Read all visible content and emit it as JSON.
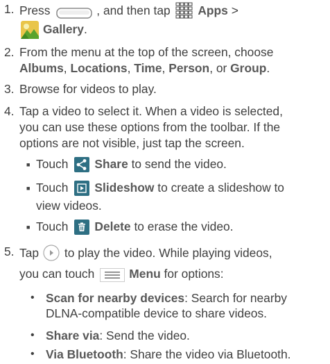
{
  "s1": {
    "num": "1.",
    "press": "Press",
    "mid": ", and then tap",
    "apps": "Apps",
    "gt": ">",
    "gallery": "Gallery",
    "end": "."
  },
  "s2": {
    "num": "2.",
    "l1": "From the menu at the top of the screen, choose",
    "albums": "Albums",
    "c1": ", ",
    "locations": "Locations",
    "c2": ", ",
    "time": "Time",
    "c3": ", ",
    "person": "Person",
    "c4": ", or ",
    "group": "Group",
    "end": "."
  },
  "s3": {
    "num": "3.",
    "text": "Browse for videos to play."
  },
  "s4": {
    "num": "4.",
    "l1": "Tap a video to select it. When a video is selected,",
    "l2": "you can use these options from the toolbar. If the",
    "l3": "options are not visible, just tap the screen."
  },
  "b1": {
    "touch": "Touch",
    "label": "Share",
    "rest": " to send the video."
  },
  "b2": {
    "touch": "Touch",
    "label": "Slideshow",
    "rest": " to create a slideshow to",
    "l2": "view videos."
  },
  "b3": {
    "touch": "Touch",
    "label": "Delete",
    "rest": " to erase the video."
  },
  "s5": {
    "num": "5.",
    "tap": "Tap",
    "rest": " to play the video. While playing videos,",
    "l2a": "you can touch",
    "menu": "Menu",
    "l2b": " for options:"
  },
  "opts": [
    {
      "label": "Scan for nearby devices",
      "desc": ": Search for nearby",
      "l2": "DLNA-compatible device to share videos."
    },
    {
      "label": "Share via",
      "desc": ": Send the video."
    },
    {
      "label": "Via Bluetooth",
      "desc": ": Share the video via Bluetooth."
    }
  ],
  "colors": {
    "text": "#3f3f3f",
    "bold": "#585858",
    "icon": "#2e6f83"
  }
}
